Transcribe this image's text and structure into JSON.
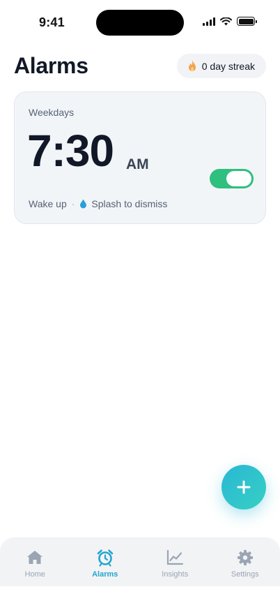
{
  "status_bar": {
    "time": "9:41"
  },
  "header": {
    "title": "Alarms",
    "streak_label": "0 day streak"
  },
  "alarm": {
    "days": "Weekdays",
    "time": "7:30",
    "ampm": "AM",
    "enabled": true,
    "label": "Wake up",
    "separator": "·",
    "dismiss_method": "Splash to dismiss"
  },
  "tabs": [
    {
      "label": "Home",
      "icon": "home-icon",
      "active": false
    },
    {
      "label": "Alarms",
      "icon": "alarm-clock-icon",
      "active": true
    },
    {
      "label": "Insights",
      "icon": "chart-icon",
      "active": false
    },
    {
      "label": "Settings",
      "icon": "gear-icon",
      "active": false
    }
  ],
  "colors": {
    "accent": "#22a5cf",
    "toggle_on": "#2fbf7f",
    "fab_start": "#2ab7d4",
    "fab_end": "#36d0c4",
    "flame": "#f4a24a",
    "drop": "#2a9fd8"
  },
  "fab": {
    "icon": "plus-icon"
  }
}
